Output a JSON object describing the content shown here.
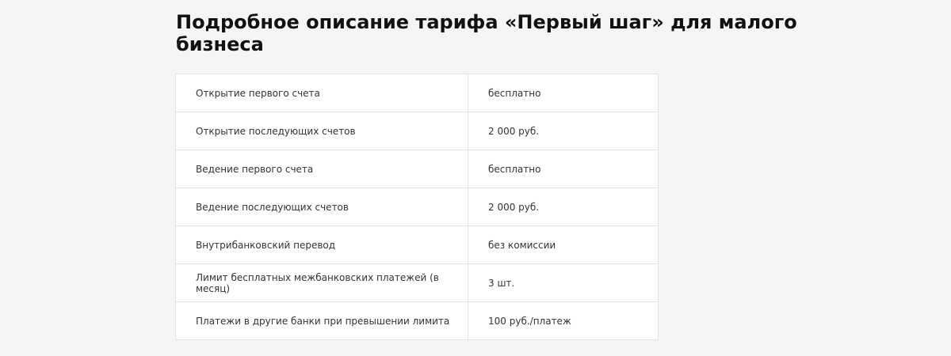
{
  "page": {
    "title": "Подробное описание тарифа «Первый шаг» для малого бизнеса"
  },
  "tariff_table": {
    "rows": [
      {
        "parameter": "Открытие первого счета",
        "value": "бесплатно"
      },
      {
        "parameter": "Открытие последующих счетов",
        "value": "2 000 руб."
      },
      {
        "parameter": "Ведение первого счета",
        "value": "бесплатно"
      },
      {
        "parameter": "Ведение последующих счетов",
        "value": "2 000 руб."
      },
      {
        "parameter": "Внутрибанковский перевод",
        "value": "без комиссии"
      },
      {
        "parameter": "Лимит бесплатных межбанковских платежей (в месяц)",
        "value": "3 шт."
      },
      {
        "parameter": "Платежи в другие банки при превышении лимита",
        "value": "100 руб./платеж"
      }
    ]
  }
}
